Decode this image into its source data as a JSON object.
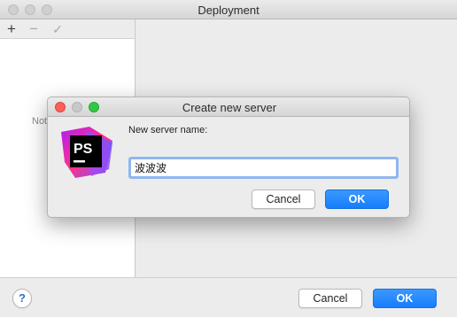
{
  "window": {
    "title": "Deployment",
    "toolbar": {
      "add_icon": "+",
      "remove_icon": "−",
      "check_icon": "✓"
    },
    "left_pane_text": "Not",
    "help_label": "?",
    "cancel_label": "Cancel",
    "ok_label": "OK"
  },
  "dialog": {
    "title": "Create new server",
    "logo_text": "PS",
    "field_label": "New server name:",
    "field_value": "波波波",
    "cancel_label": "Cancel",
    "ok_label": "OK"
  },
  "colors": {
    "accent": "#157efb",
    "close": "#fc5f57",
    "maximize": "#33c748",
    "logo_magenta": "#dd1ea6",
    "logo_purple": "#7b3ff2"
  }
}
